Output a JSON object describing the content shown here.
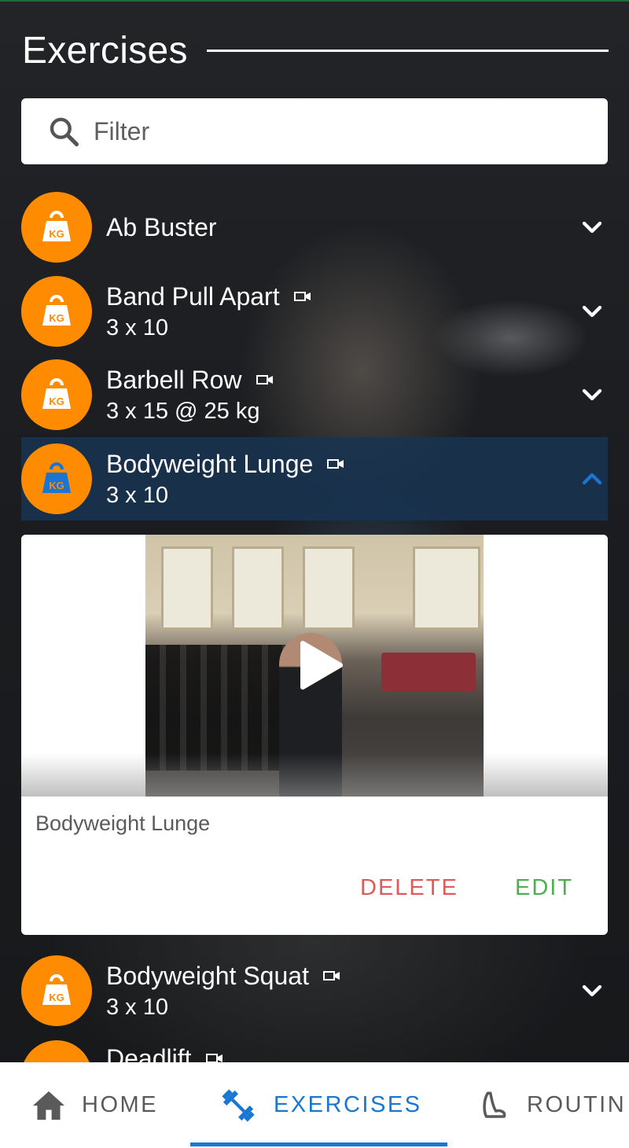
{
  "header": {
    "title": "Exercises"
  },
  "filter": {
    "placeholder": "Filter",
    "icon": "search-icon"
  },
  "exercises": [
    {
      "name": "Ab Buster",
      "detail": "",
      "has_video": false,
      "expanded": false
    },
    {
      "name": "Band Pull Apart",
      "detail": "3 x 10",
      "has_video": true,
      "expanded": false
    },
    {
      "name": "Barbell Row",
      "detail": "3 x 15 @ 25 kg",
      "has_video": true,
      "expanded": false
    },
    {
      "name": "Bodyweight Lunge",
      "detail": "3 x 10",
      "has_video": true,
      "expanded": true
    },
    {
      "name": "Bodyweight Squat",
      "detail": "3 x 10",
      "has_video": true,
      "expanded": false
    },
    {
      "name": "Deadlift",
      "detail": "",
      "has_video": true,
      "expanded": false
    }
  ],
  "detail_card": {
    "caption": "Bodyweight Lunge",
    "delete_label": "DELETE",
    "edit_label": "EDIT"
  },
  "bottom_nav": {
    "tabs": [
      {
        "label": "HOME",
        "icon": "home-icon",
        "active": false
      },
      {
        "label": "EXERCISES",
        "icon": "dumbbell-icon",
        "active": true
      },
      {
        "label": "ROUTIN",
        "icon": "routines-icon",
        "active": false
      }
    ]
  },
  "colors": {
    "accent": "#1976d2",
    "avatar": "#ff8c00",
    "delete": "#e05a5a",
    "edit": "#4caf50",
    "active_row": "#183452"
  }
}
